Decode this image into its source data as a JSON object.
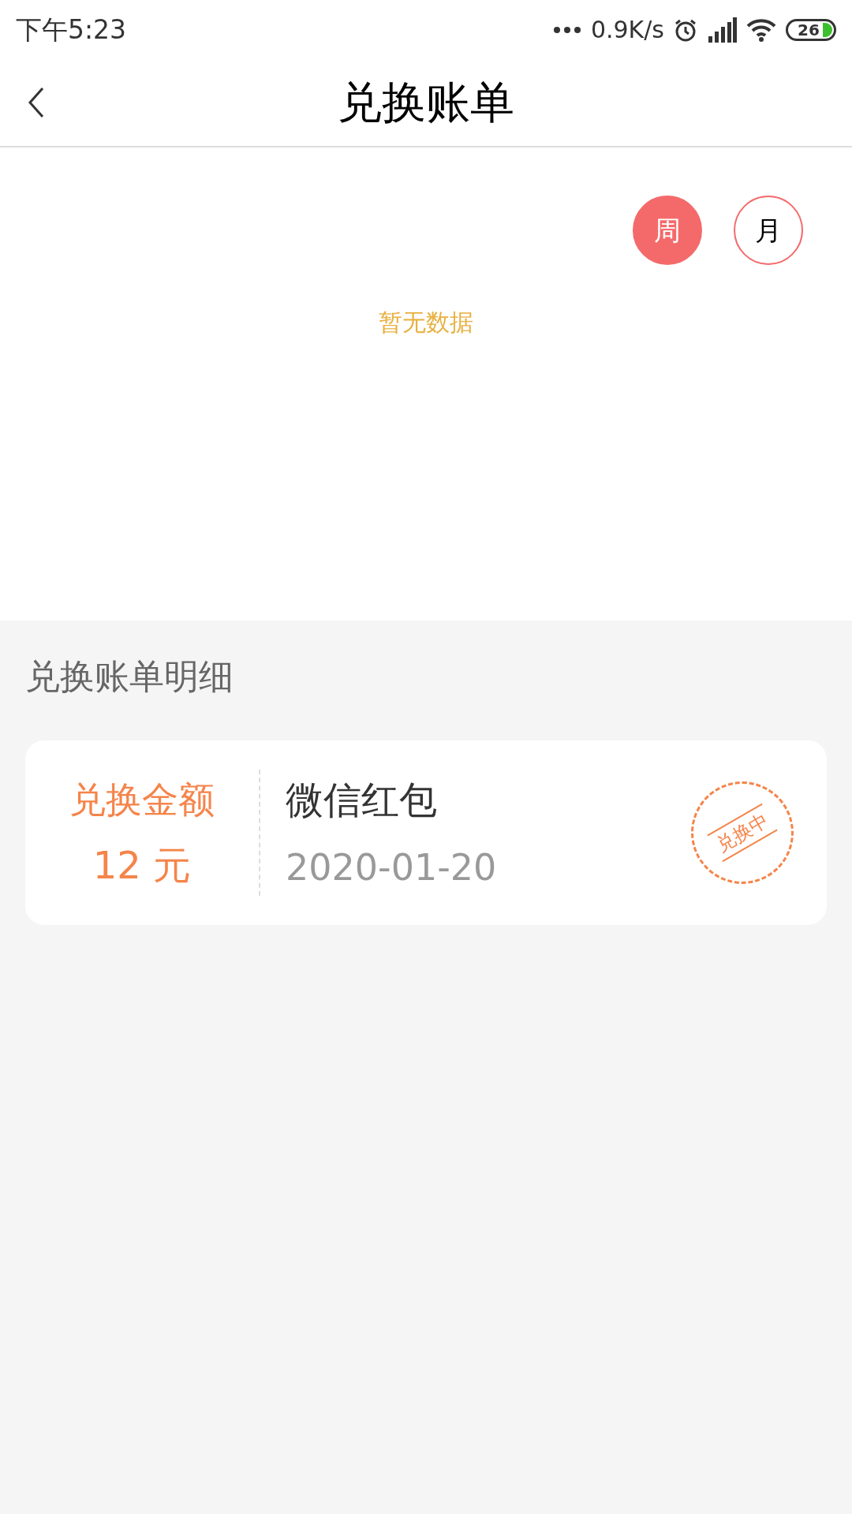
{
  "status_bar": {
    "time": "下午5:23",
    "net_speed": "0.9K/s",
    "battery": "26"
  },
  "header": {
    "title": "兑换账单"
  },
  "periods": [
    {
      "label": "周",
      "selected": true
    },
    {
      "label": "月",
      "selected": false
    }
  ],
  "chart": {
    "empty_text": "暂无数据"
  },
  "details": {
    "heading": "兑换账单明细",
    "items": [
      {
        "amount_label": "兑换金额",
        "amount": "12 元",
        "title": "微信红包",
        "date": "2020-01-20",
        "status": "兑换中"
      }
    ]
  }
}
